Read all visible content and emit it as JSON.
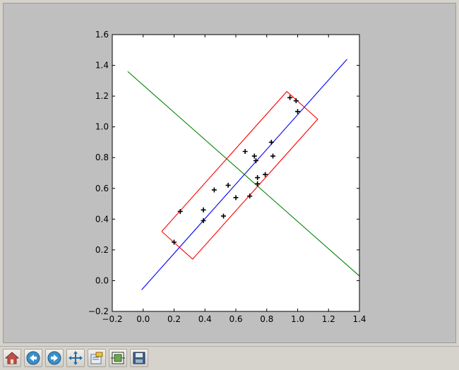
{
  "toolbar": {
    "buttons": [
      {
        "id": "home",
        "icon": "home-icon"
      },
      {
        "id": "back",
        "icon": "back-arrow-icon"
      },
      {
        "id": "forward",
        "icon": "forward-arrow-icon"
      },
      {
        "id": "pan",
        "icon": "pan-move-icon"
      },
      {
        "id": "zoom",
        "icon": "zoom-rect-icon"
      },
      {
        "id": "subplots",
        "icon": "configure-subplots-icon"
      },
      {
        "id": "save",
        "icon": "save-floppy-icon"
      }
    ]
  },
  "chart_data": {
    "type": "scatter",
    "title": "",
    "xlabel": "",
    "ylabel": "",
    "xlim": [
      -0.2,
      1.4
    ],
    "ylim": [
      -0.2,
      1.6
    ],
    "xticks": [
      "−0.2",
      "0.0",
      "0.2",
      "0.4",
      "0.6",
      "0.8",
      "1.0",
      "1.2",
      "1.4"
    ],
    "yticks": [
      "−0.2",
      "0.0",
      "0.2",
      "0.4",
      "0.6",
      "0.8",
      "1.0",
      "1.2",
      "1.4",
      "1.6"
    ],
    "grid": false,
    "colors": {
      "points": "#000000",
      "principal_axis": "#0000ff",
      "perpendicular_axis": "#008000",
      "bounding_box": "#ff0000",
      "axes_bg": "#ffffff",
      "figure_bg": "#bfbfbf"
    },
    "points": {
      "marker": "+",
      "x": [
        0.2,
        0.24,
        0.39,
        0.39,
        0.46,
        0.52,
        0.55,
        0.6,
        0.66,
        0.69,
        0.72,
        0.73,
        0.74,
        0.74,
        0.79,
        0.83,
        0.84,
        0.95,
        0.99,
        1.0
      ],
      "y": [
        0.25,
        0.45,
        0.46,
        0.39,
        0.59,
        0.42,
        0.62,
        0.54,
        0.84,
        0.55,
        0.81,
        0.78,
        0.63,
        0.67,
        0.69,
        0.9,
        0.81,
        1.19,
        1.17,
        1.1
      ]
    },
    "lines": [
      {
        "role": "principal_axis",
        "x": [
          -0.01,
          1.32
        ],
        "y": [
          -0.06,
          1.44
        ]
      },
      {
        "role": "perpendicular_axis",
        "x": [
          -0.1,
          1.4
        ],
        "y": [
          1.36,
          0.03
        ]
      }
    ],
    "polygon": {
      "role": "bounding_box",
      "x": [
        0.12,
        0.93,
        1.13,
        0.32,
        0.12
      ],
      "y": [
        0.32,
        1.23,
        1.05,
        0.14,
        0.32
      ]
    }
  }
}
